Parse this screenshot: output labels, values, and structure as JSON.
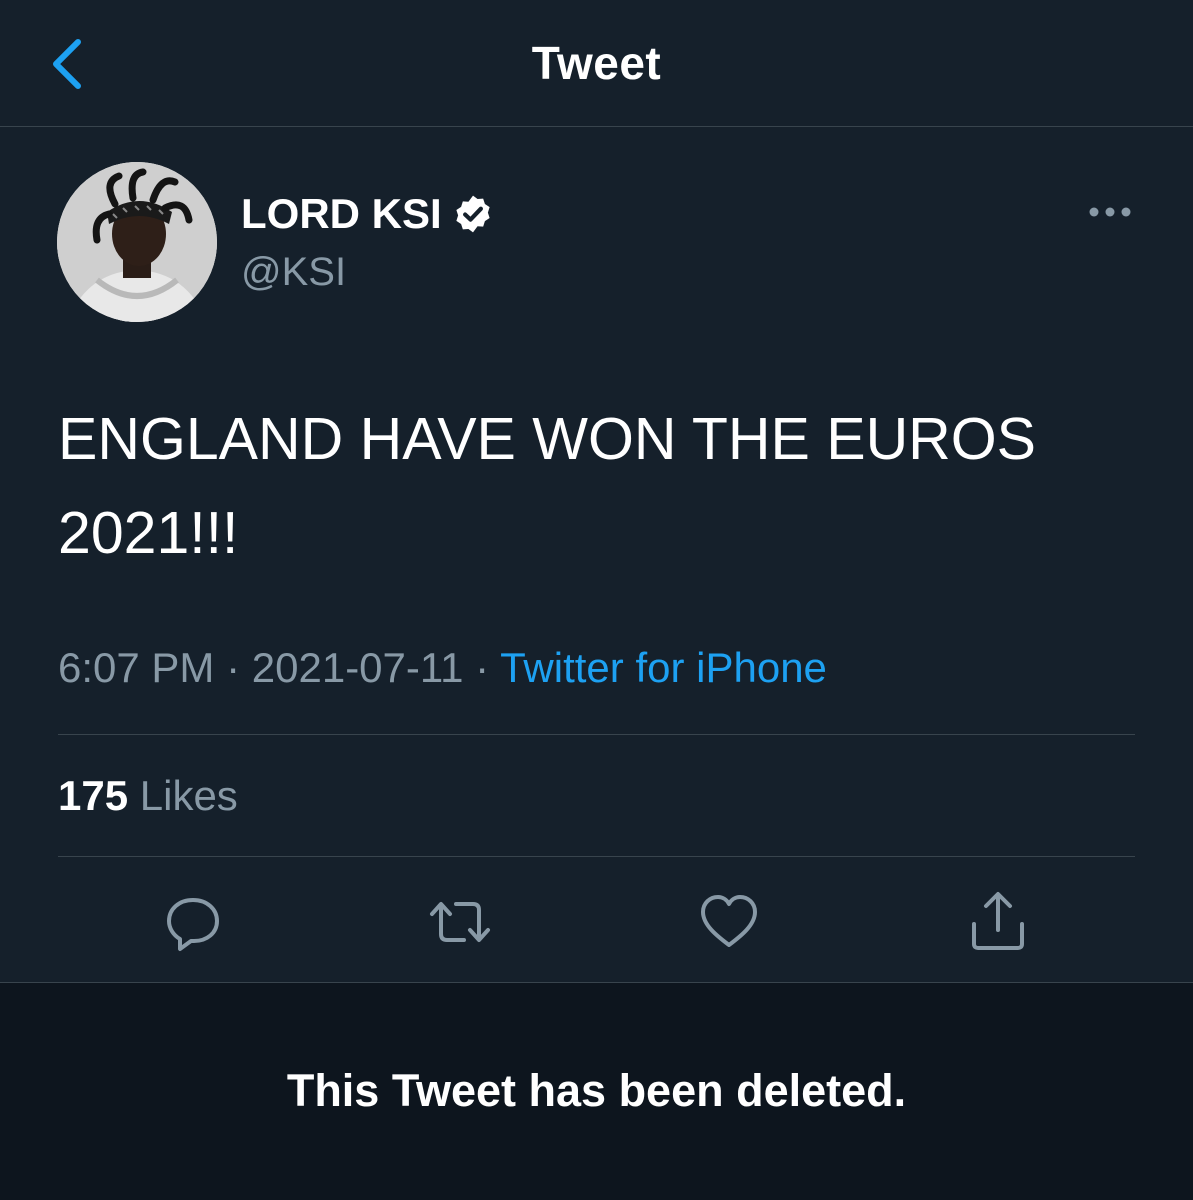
{
  "header": {
    "title": "Tweet",
    "back_icon": "chevron-left-icon"
  },
  "author": {
    "display_name": "LORD KSI",
    "handle": "@KSI",
    "verified": true
  },
  "tweet": {
    "text": "ENGLAND HAVE WON THE EUROS 2021!!!",
    "time": "6:07 PM",
    "separator": "·",
    "date": "2021-07-11",
    "source": "Twitter for iPhone"
  },
  "stats": {
    "likes_count": "175",
    "likes_label": "Likes"
  },
  "actions": [
    {
      "name": "reply",
      "icon": "reply-icon"
    },
    {
      "name": "retweet",
      "icon": "retweet-icon"
    },
    {
      "name": "like",
      "icon": "heart-icon"
    },
    {
      "name": "share",
      "icon": "share-icon"
    }
  ],
  "footer": {
    "message": "This Tweet has been deleted."
  },
  "colors": {
    "background": "#15202b",
    "accent": "#1da1f2",
    "secondary_text": "#8899a6",
    "border": "#38444d",
    "footer_background": "#0d151e"
  }
}
